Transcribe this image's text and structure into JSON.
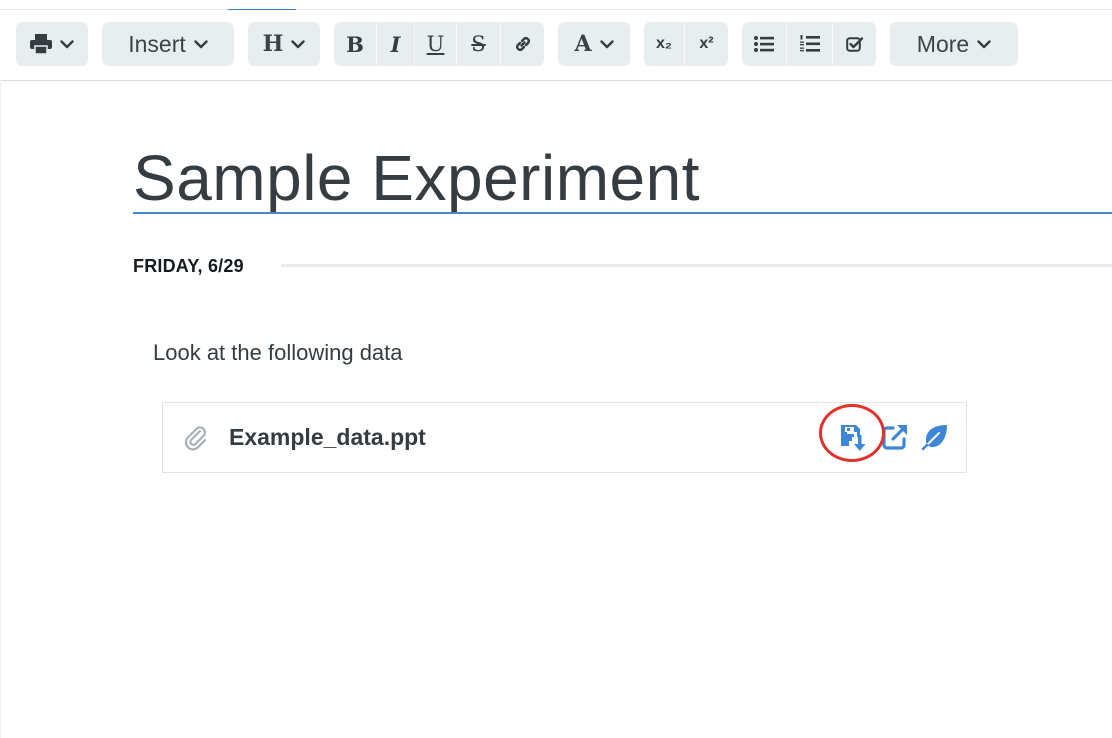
{
  "toolbar": {
    "insert_label": "Insert",
    "heading_label": "H",
    "bold_label": "B",
    "italic_label": "I",
    "underline_label": "U",
    "strike_label": "S",
    "font_color_label": "A",
    "subscript_label": "x₂",
    "superscript_label": "x²",
    "more_label": "More"
  },
  "document": {
    "title": "Sample Experiment",
    "date_heading": "FRIDAY, 6/29",
    "body_text": "Look at the following data",
    "attachment": {
      "file_name": "Example_data.ppt",
      "icons": [
        "paperclip-icon",
        "save-download-icon",
        "open-external-icon",
        "leaf-icon"
      ]
    }
  },
  "colors": {
    "accent_blue": "#4a86cc",
    "toolbar_button_bg": "#e8eef0",
    "highlight_circle": "#e5302b",
    "attachment_icon_blue": "#3d86d8"
  }
}
